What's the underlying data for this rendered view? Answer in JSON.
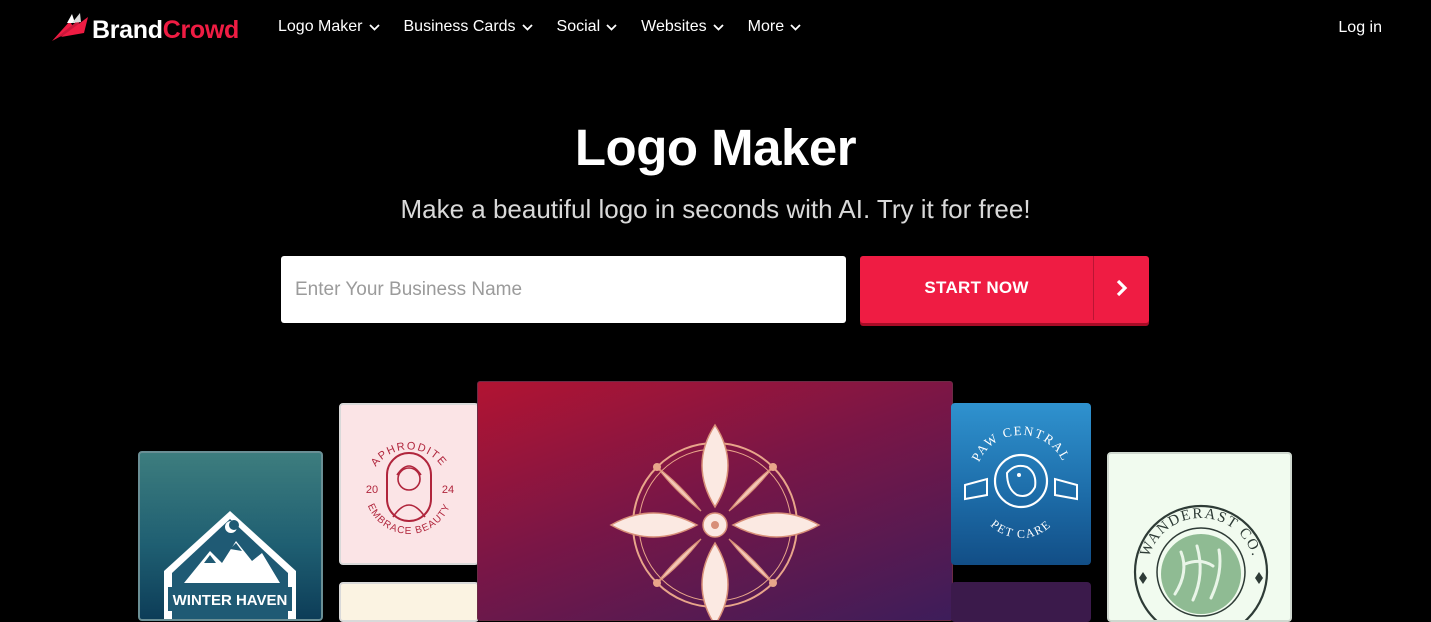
{
  "nav": {
    "brand_part1": "Brand",
    "brand_part2": "Crowd",
    "menu": [
      {
        "label": "Logo Maker"
      },
      {
        "label": "Business Cards"
      },
      {
        "label": "Social"
      },
      {
        "label": "Websites"
      },
      {
        "label": "More"
      }
    ],
    "login": "Log in"
  },
  "hero": {
    "title": "Logo Maker",
    "subtitle": "Make a beautiful logo in seconds with AI. Try it for free!",
    "input_placeholder": "Enter Your Business Name",
    "input_value": "",
    "cta_label": "START NOW"
  },
  "cards": {
    "winter": {
      "text": "WINTER HAVEN"
    },
    "aphrodite": {
      "top": "APHRODITE",
      "year_left": "20",
      "year_right": "24",
      "bottom": "EMBRACE BEAUTY"
    },
    "paw": {
      "top": "PAW CENTRAL",
      "bottom": "PET CARE"
    },
    "wanderast": {
      "top": "WANDERAST CO."
    }
  },
  "colors": {
    "accent": "#ef1c43",
    "background": "#000000"
  },
  "icons": {
    "logo": "brandcrowd-wing-icon",
    "menu_caret": "chevron-down-icon",
    "cta_arrow": "chevron-right-icon"
  }
}
